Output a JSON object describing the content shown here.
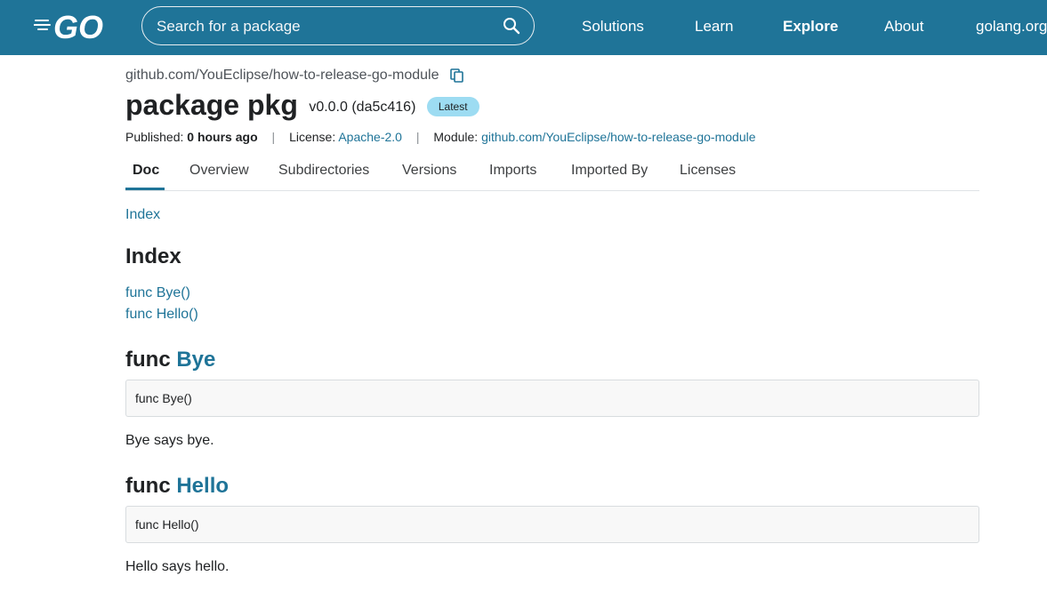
{
  "header": {
    "logo_text": "GO",
    "search": {
      "placeholder": "Search for a package"
    },
    "nav": [
      "Solutions",
      "Learn",
      "Explore",
      "About",
      "golang.org"
    ]
  },
  "package": {
    "module_path": "github.com/YouEclipse/how-to-release-go-module",
    "title": "package pkg",
    "version": "v0.0.0 (da5c416)",
    "badge": "Latest",
    "published_label": "Published:",
    "published_value": "0 hours ago",
    "separator": "|",
    "license_label": "License:",
    "license_value": "Apache-2.0",
    "module_label": "Module:",
    "module_value": "github.com/YouEclipse/how-to-release-go-module"
  },
  "tabs": [
    "Doc",
    "Overview",
    "Subdirectories",
    "Versions",
    "Imports",
    "Imported By",
    "Licenses"
  ],
  "doc": {
    "index_link": "Index",
    "index_heading": "Index",
    "index_items": [
      "func Bye()",
      "func Hello()"
    ],
    "funcs": [
      {
        "keyword": "func",
        "name": "Bye",
        "signature": "func Bye()",
        "description": "Bye says bye."
      },
      {
        "keyword": "func",
        "name": "Hello",
        "signature": "func Hello()",
        "description": "Hello says hello."
      }
    ]
  },
  "colors": {
    "header_bg": "#1f7498",
    "link": "#1f7498",
    "badge": "#9ddcf2"
  },
  "icons": {
    "search": "search-icon",
    "copy": "copy-icon"
  }
}
